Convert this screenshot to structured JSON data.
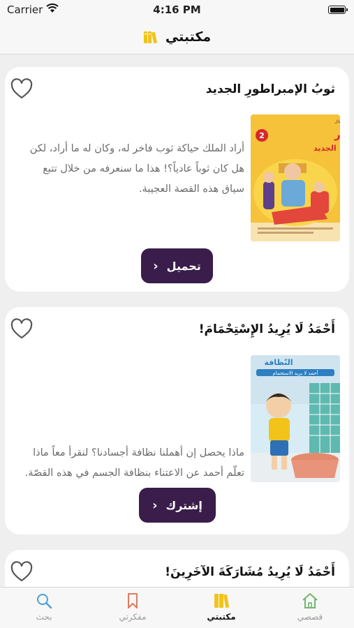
{
  "status_bar": {
    "carrier": "Carrier",
    "time": "4:16 PM"
  },
  "nav": {
    "title": "مكتبتي",
    "icon": "books-icon"
  },
  "cards": [
    {
      "title": "ثوبُ الإمبراطورِ الجديد",
      "description": "أراد الملك حياكة ثوب فاخر له، وكان له ما أراد، لكن هل كان ثوباً عادياً؟!  هذا ما سنعرفه من خلال تتبع سياق هذه القصة العجيبة.",
      "button_label": "تحميل",
      "cover": {
        "series": "سلسلة الأطفال",
        "title": "ثَوبُ الإمبَراطور الجديد",
        "number": "2",
        "bg": "#f5c23a",
        "accent": "#d8262c"
      }
    },
    {
      "title": "أَحْمَدُ لَا يُرِيدُ الإِسْتِحْمَامَ!",
      "description": "ماذا يحصل إن أهملنا نظافة أجسادنا؟ لنقرأ معاً ماذا تعلّم أحمد عن الاعتناء بنظافة الجسم في هذه القصّة.",
      "button_label": "إشترك",
      "cover": {
        "series": "النّظافة",
        "title": "أحمد لا يريد الاستحمام",
        "bg": "#d7ecf5",
        "accent": "#2e7fc1"
      }
    },
    {
      "title": "أَحْمَدُ لَا يُرِيدُ مُشَارَكَةَ الآخَرِينَ!"
    }
  ],
  "tabs": [
    {
      "label": "قصصي",
      "icon": "home-icon",
      "color": "#6fb86a"
    },
    {
      "label": "مكتبتي",
      "icon": "books-icon",
      "color": "#f2c319"
    },
    {
      "label": "مفكرتي",
      "icon": "bookmark-icon",
      "color": "#e07a5f"
    },
    {
      "label": "بحث",
      "icon": "search-icon",
      "color": "#4a9fd8"
    }
  ],
  "colors": {
    "button": "#3a1d4a",
    "background": "#efefef",
    "active_tab": "#f2c319"
  }
}
